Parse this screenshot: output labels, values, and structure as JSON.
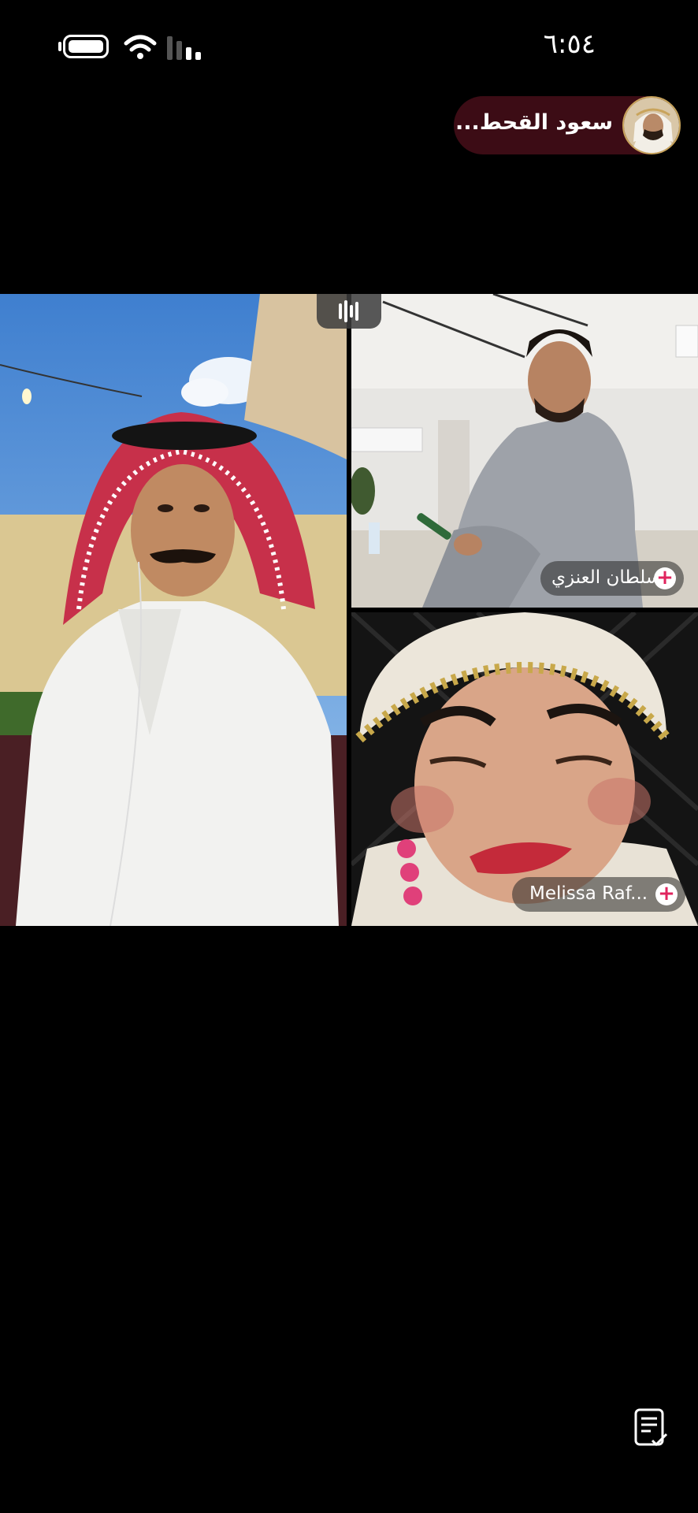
{
  "status_bar": {
    "time": "٦:٥٤",
    "battery_icon": "battery-icon",
    "wifi_icon": "wifi-icon",
    "signal_icon": "cellular-signal-icon"
  },
  "host": {
    "name": "سعود القحط...",
    "avatar_icon": "host-avatar"
  },
  "call": {
    "audio_indicator_icon": "audio-wave-icon",
    "participants": [
      {
        "name": ""
      },
      {
        "name": "سلطان العنزي",
        "action_icon": "add-icon"
      },
      {
        "name": "Melissa Raf...",
        "action_icon": "add-icon"
      }
    ]
  },
  "toolbar": {
    "notes_icon": "notes-check-icon"
  },
  "colors": {
    "background": "#000000",
    "host_pill": "#3c0c15",
    "plus_accent": "#e0245e"
  }
}
